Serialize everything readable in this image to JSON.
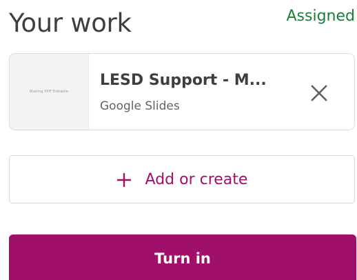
{
  "header": {
    "title": "Your work",
    "status": "Assigned"
  },
  "attachment": {
    "thumbnail_text": "Making PDF Editable",
    "name": "LESD Support - M...",
    "type": "Google Slides",
    "remove_icon": "close-icon"
  },
  "add": {
    "icon": "plus-icon",
    "label": "Add or create"
  },
  "submit": {
    "label": "Turn in"
  },
  "colors": {
    "accent": "#a0106a",
    "status": "#188038",
    "text": "#3c4043",
    "secondary_text": "#5f6368",
    "border": "#dadce0"
  }
}
